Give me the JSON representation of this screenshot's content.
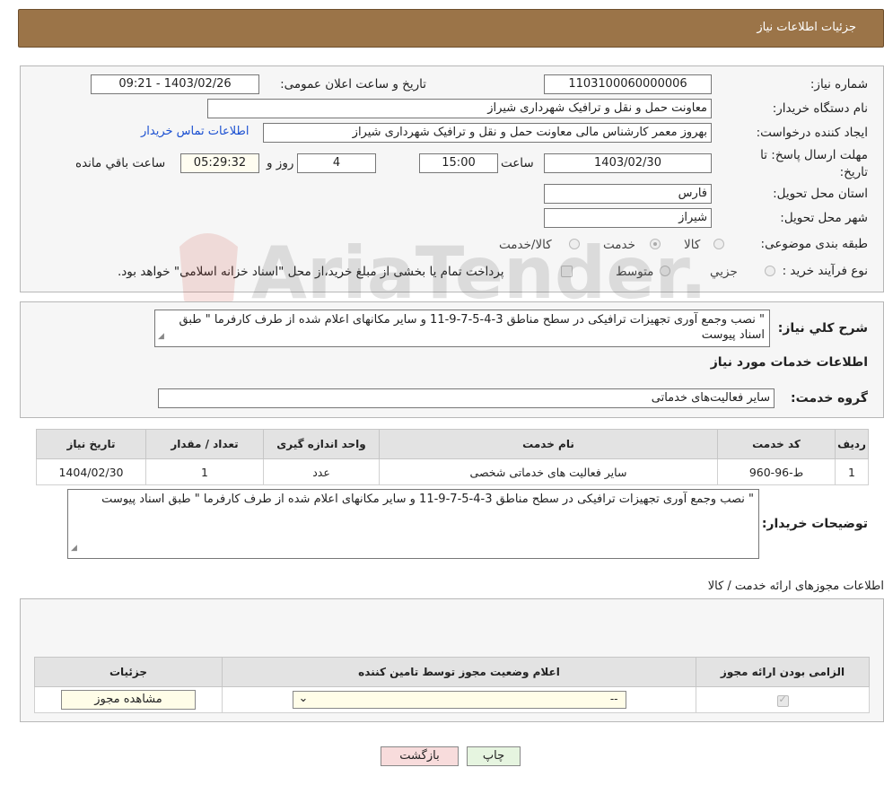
{
  "header": {
    "title": "جزئیات اطلاعات نیاز"
  },
  "form": {
    "need_number_label": "شماره نیاز:",
    "need_number": "1103100060000006",
    "announce_label": "تاریخ و ساعت اعلان عمومی:",
    "announce_value": "1403/02/26 - 09:21",
    "buyer_org_label": "نام دستگاه خریدار:",
    "buyer_org": "معاونت حمل و نقل و ترافیک شهرداری شیراز",
    "creator_label": "ایجاد کننده درخواست:",
    "creator": "بهروز معمر کارشناس مالی معاونت حمل و نقل و ترافیک شهرداری شیراز",
    "contact_link": "اطلاعات تماس خریدار",
    "deadline_label": "مهلت ارسال پاسخ: تا تاریخ:",
    "deadline_date": "1403/02/30",
    "time_label": "ساعت",
    "deadline_time": "15:00",
    "days_value": "4",
    "days_label": "روز و",
    "remaining_time": "05:29:32",
    "remaining_label": "ساعت باقي مانده",
    "province_label": "استان محل تحویل:",
    "province": "فارس",
    "city_label": "شهر محل تحویل:",
    "city": "شیراز",
    "category_label": "طبقه بندی موضوعی:",
    "category_options": [
      {
        "label": "کالا",
        "selected": false
      },
      {
        "label": "خدمت",
        "selected": true
      },
      {
        "label": "کالا/خدمت",
        "selected": false
      }
    ],
    "process_label": "نوع فرآیند خرید :",
    "process_options": [
      {
        "label": "جزیي",
        "selected": false
      },
      {
        "label": "متوسط",
        "selected": false
      }
    ],
    "payment_note": "پرداخت تمام یا بخشی از مبلغ خرید،از محل \"اسناد خزانه اسلامی\" خواهد بود."
  },
  "summary": {
    "label": "شرح کلي نیاز:",
    "text": "\" نصب وجمع آوری تجهیزات ترافیکی در سطح مناطق 3-4-5-7-9-11 و سایر مکانهای اعلام شده از طرف کارفرما \" طبق اسناد پیوست",
    "services_title": "اطلاعات خدمات مورد نیاز",
    "service_group_label": "گروه خدمت:",
    "service_group": "سایر فعالیت‌های خدماتی"
  },
  "services_table": {
    "headers": [
      "ردیف",
      "کد خدمت",
      "نام خدمت",
      "واحد اندازه گیری",
      "تعداد / مقدار",
      "تاریخ نیاز"
    ],
    "rows": [
      [
        "1",
        "ط-96-960",
        "سایر فعالیت های خدماتی شخصی",
        "عدد",
        "1",
        "1404/02/30"
      ]
    ]
  },
  "buyer_notes": {
    "label": "توضیحات خریدار:",
    "text": "\" نصب وجمع آوری تجهیزات ترافیکی در سطح مناطق 3-4-5-7-9-11 و سایر مکانهای اعلام شده از طرف کارفرما \" طبق اسناد پیوست"
  },
  "permits": {
    "title": "اطلاعات مجوزهای ارائه خدمت / کالا",
    "headers": [
      "الزامی بودن ارائه مجوز",
      "اعلام وضعیت مجوز توسط تامین کننده",
      "جزئیات"
    ],
    "select_value": "--",
    "view_button": "مشاهده مجوز"
  },
  "actions": {
    "print": "چاپ",
    "back": "بازگشت"
  },
  "watermark": "AriaTender.neT"
}
